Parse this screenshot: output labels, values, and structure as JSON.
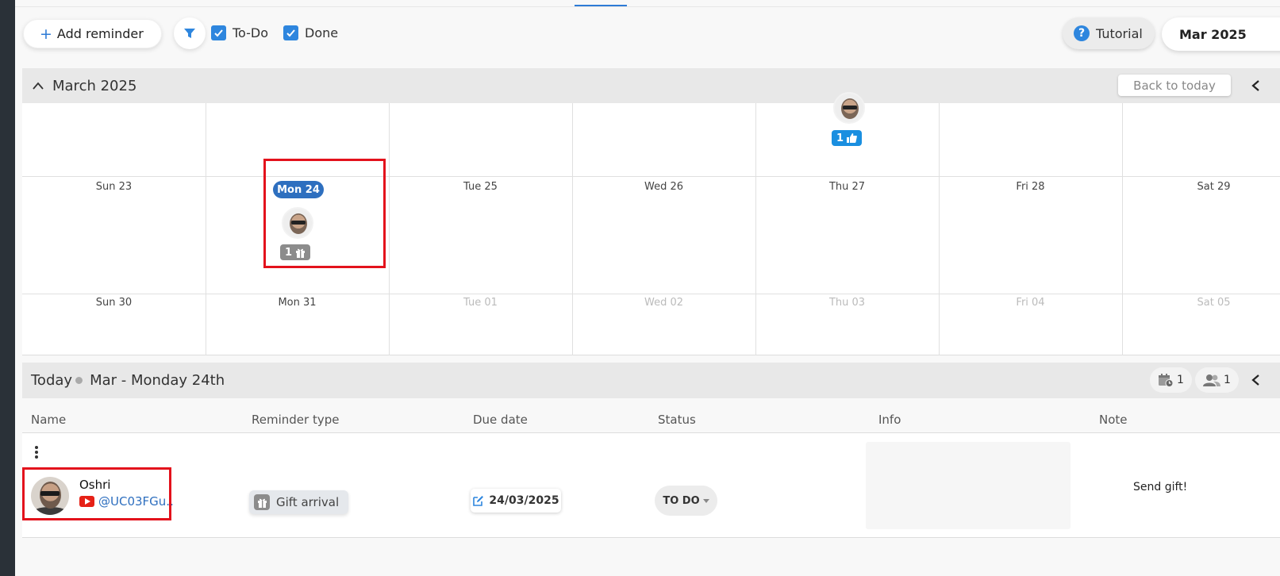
{
  "toolbar": {
    "add_label": "Add reminder",
    "todo_label": "To-Do",
    "done_label": "Done",
    "tutorial_label": "Tutorial",
    "month_value": "Mar 2025"
  },
  "calendar": {
    "title": "March 2025",
    "back_label": "Back to today",
    "week_partial": {
      "thu_badge": "1"
    },
    "week1": [
      "Sun 23",
      "Mon 24",
      "Tue 25",
      "Wed 26",
      "Thu 27",
      "Fri 28",
      "Sat 29"
    ],
    "week1_badge": "1",
    "week2": [
      "Sun 30",
      "Mon 31",
      "Tue 01",
      "Wed 02",
      "Thu 03",
      "Fri 04",
      "Sat 05"
    ]
  },
  "today": {
    "label": "Today",
    "date": "Mar - Monday 24th",
    "events_count": "1",
    "people_count": "1"
  },
  "table": {
    "headers": [
      "Name",
      "Reminder type",
      "Due date",
      "Status",
      "Info",
      "Note"
    ],
    "rows": [
      {
        "name": "Oshri",
        "handle": "@UC03FGu...",
        "type": "Gift arrival",
        "due": "24/03/2025",
        "status": "TO DO",
        "note": "Send gift!"
      }
    ]
  },
  "colors": {
    "accent": "#2e7bd6",
    "highlight": "#e3121c",
    "like_badge": "#1a8fe0",
    "gift_badge": "#8c8c8c"
  }
}
